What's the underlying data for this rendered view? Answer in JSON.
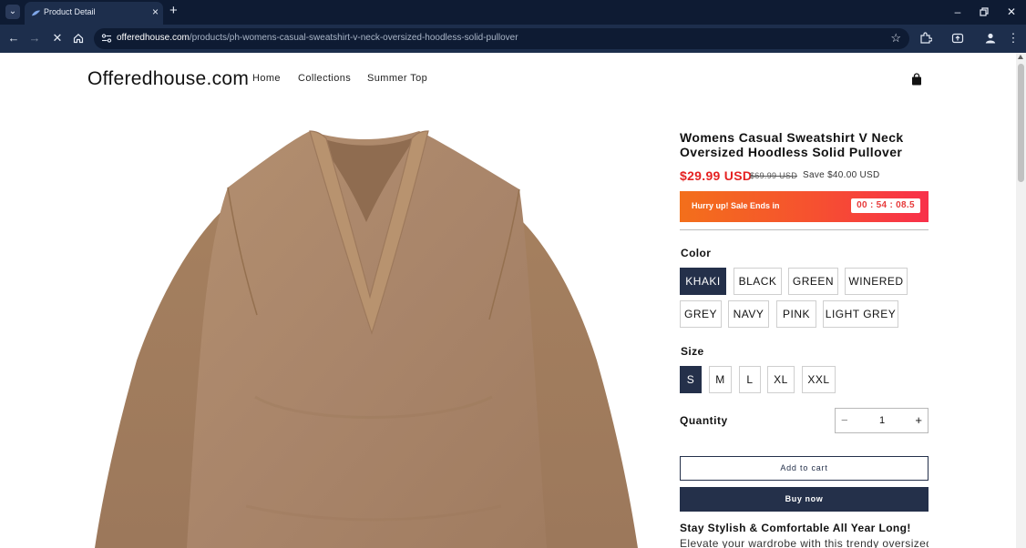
{
  "browser": {
    "tab_title": "Product Detail",
    "url_host": "offeredhouse.com",
    "url_path": "/products/ph-womens-casual-sweatshirt-v-neck-oversized-hoodless-solid-pullover",
    "colors": {
      "tabbar": "#0e1b33",
      "toolbar": "#1d2e4c"
    }
  },
  "header": {
    "logo": "Offeredhouse.com",
    "nav": [
      "Home",
      "Collections",
      "Summer Top"
    ]
  },
  "product": {
    "title": "Womens Casual Sweatshirt V Neck Oversized Hoodless Solid Pullover",
    "price": "$29.99 USD",
    "compare_price": "$69.99 USD",
    "save_text": "Save $40.00 USD",
    "sale_banner": {
      "text": "Hurry up! Sale Ends in",
      "timer": "00 : 54 : 08.5"
    },
    "color_label": "Color",
    "colors": [
      "KHAKI",
      "BLACK",
      "GREEN",
      "WINERED",
      "GREY",
      "NAVY",
      "PINK",
      "LIGHT GREY"
    ],
    "selected_color": "KHAKI",
    "size_label": "Size",
    "sizes": [
      "S",
      "M",
      "L",
      "XL",
      "XXL"
    ],
    "selected_size": "S",
    "quantity_label": "Quantity",
    "quantity": "1",
    "add_to_cart": "Add to cart",
    "buy_now": "Buy now",
    "description_heading": "Stay Stylish & Comfortable All Year Long!",
    "description_text": "Elevate your wardrobe with this trendy oversized",
    "accent_color": "#24304a",
    "price_color": "#e52222"
  }
}
